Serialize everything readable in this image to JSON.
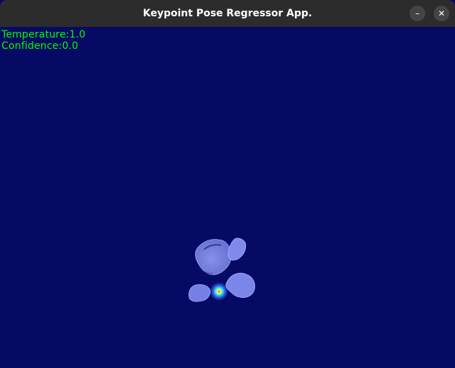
{
  "window": {
    "title": "Keypoint Pose Regressor App.",
    "minimize_icon": "minimize-icon",
    "close_icon": "close-icon",
    "minimize_glyph": "–",
    "close_glyph": "✕"
  },
  "overlay": {
    "temperature_text": "Temperature:1.0",
    "confidence_text": "Confidence:0.0",
    "text_color": "#00ff00"
  },
  "viewport": {
    "background_color": "#070a64",
    "model_color": "#7b86e8",
    "keypoint_color": "#2fe3ff"
  }
}
